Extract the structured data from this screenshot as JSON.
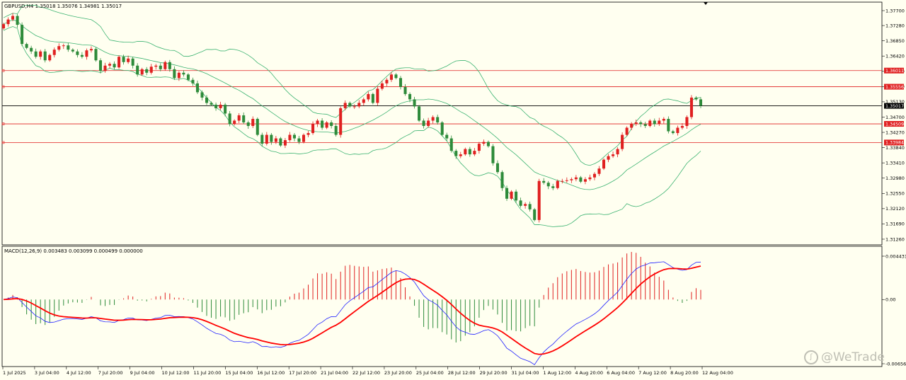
{
  "symbol_header": "GBPUSD,H4  1.35018 1.35076 1.34981 1.35017",
  "macd_header": "MACD(12,26,9) 0.003483 0.003099 0.000499 0.000000",
  "price_ticks": [
    "1.37700",
    "1.37280",
    "1.36850",
    "1.36420",
    "1.35990",
    "1.35560",
    "1.35130",
    "1.34700",
    "1.34270",
    "1.33840",
    "1.33410",
    "1.32980",
    "1.32550",
    "1.32120",
    "1.31690",
    "1.31260"
  ],
  "macd_ticks": [
    "0.004431",
    "0.00",
    "-0.006562"
  ],
  "time_ticks": [
    "1 Jul 2025",
    "3 Jul 04:00",
    "4 Jul 12:00",
    "7 Jul 20:00",
    "9 Jul 04:00",
    "10 Jul 12:00",
    "11 Jul 20:00",
    "15 Jul 04:00",
    "16 Jul 12:00",
    "17 Jul 20:00",
    "21 Jul 04:00",
    "22 Jul 12:00",
    "23 Jul 20:00",
    "25 Jul 04:00",
    "28 Jul 12:00",
    "29 Jul 20:00",
    "31 Jul 04:00",
    "1 Aug 12:00",
    "4 Aug 20:00",
    "6 Aug 04:00",
    "7 Aug 12:00",
    "8 Aug 20:00",
    "12 Aug 04:00"
  ],
  "levels": [
    {
      "label": "1.36011",
      "value": 1.36011,
      "kind": "support-resistance"
    },
    {
      "label": "1.35556",
      "value": 1.35556,
      "kind": "support-resistance"
    },
    {
      "label": "1.35017",
      "value": 1.35017,
      "kind": "current-price"
    },
    {
      "label": "1.34509",
      "value": 1.34509,
      "kind": "support-resistance"
    },
    {
      "label": "1.33984",
      "value": 1.33984,
      "kind": "support-resistance"
    }
  ],
  "watermark": "@WeTrade",
  "colors": {
    "bg": "#fffff0",
    "bull": "#e02020",
    "bear": "#2e8b3a",
    "level": "#e02020",
    "band": "#3cb371",
    "macd": "#2020ff",
    "signal": "#ff0000",
    "hist_pos": "#e02020",
    "hist_neg": "#2e8b3a",
    "axis": "#000000"
  },
  "chart_data": {
    "type": "candlestick",
    "title": "",
    "symbol": "GBPUSD",
    "timeframe": "H4",
    "ylim": [
      1.3114,
      1.3784
    ],
    "closes": [
      1.3732,
      1.3745,
      1.3755,
      1.373,
      1.3676,
      1.3665,
      1.3655,
      1.364,
      1.3655,
      1.363,
      1.3645,
      1.366,
      1.367,
      1.3672,
      1.366,
      1.3655,
      1.3645,
      1.364,
      1.3658,
      1.3662,
      1.363,
      1.36,
      1.3615,
      1.362,
      1.361,
      1.364,
      1.3625,
      1.3635,
      1.3615,
      1.359,
      1.3605,
      1.3595,
      1.3612,
      1.3615,
      1.3605,
      1.3625,
      1.3605,
      1.358,
      1.3595,
      1.359,
      1.3575,
      1.3565,
      1.354,
      1.3525,
      1.351,
      1.3505,
      1.3495,
      1.3505,
      1.348,
      1.345,
      1.346,
      1.3475,
      1.3455,
      1.3445,
      1.3465,
      1.342,
      1.3395,
      1.342,
      1.34,
      1.341,
      1.339,
      1.3405,
      1.342,
      1.341,
      1.34,
      1.342,
      1.3425,
      1.345,
      1.346,
      1.344,
      1.3455,
      1.3445,
      1.342,
      1.3495,
      1.351,
      1.35,
      1.35,
      1.351,
      1.352,
      1.3535,
      1.351,
      1.355,
      1.3565,
      1.3575,
      1.359,
      1.358,
      1.3555,
      1.3535,
      1.352,
      1.35,
      1.346,
      1.3445,
      1.346,
      1.347,
      1.3455,
      1.342,
      1.341,
      1.3375,
      1.336,
      1.3365,
      1.338,
      1.3365,
      1.3375,
      1.3395,
      1.34,
      1.3388,
      1.334,
      1.3315,
      1.327,
      1.324,
      1.326,
      1.3235,
      1.322,
      1.3225,
      1.321,
      1.318,
      1.329,
      1.3285,
      1.3275,
      1.327,
      1.329,
      1.329,
      1.3292,
      1.3295,
      1.33,
      1.3288,
      1.3295,
      1.33,
      1.331,
      1.3325,
      1.335,
      1.336,
      1.3365,
      1.338,
      1.342,
      1.344,
      1.345,
      1.3455,
      1.345,
      1.3445,
      1.346,
      1.345,
      1.346,
      1.3465,
      1.343,
      1.3425,
      1.344,
      1.3445,
      1.347,
      1.3525,
      1.352,
      1.3502
    ]
  }
}
